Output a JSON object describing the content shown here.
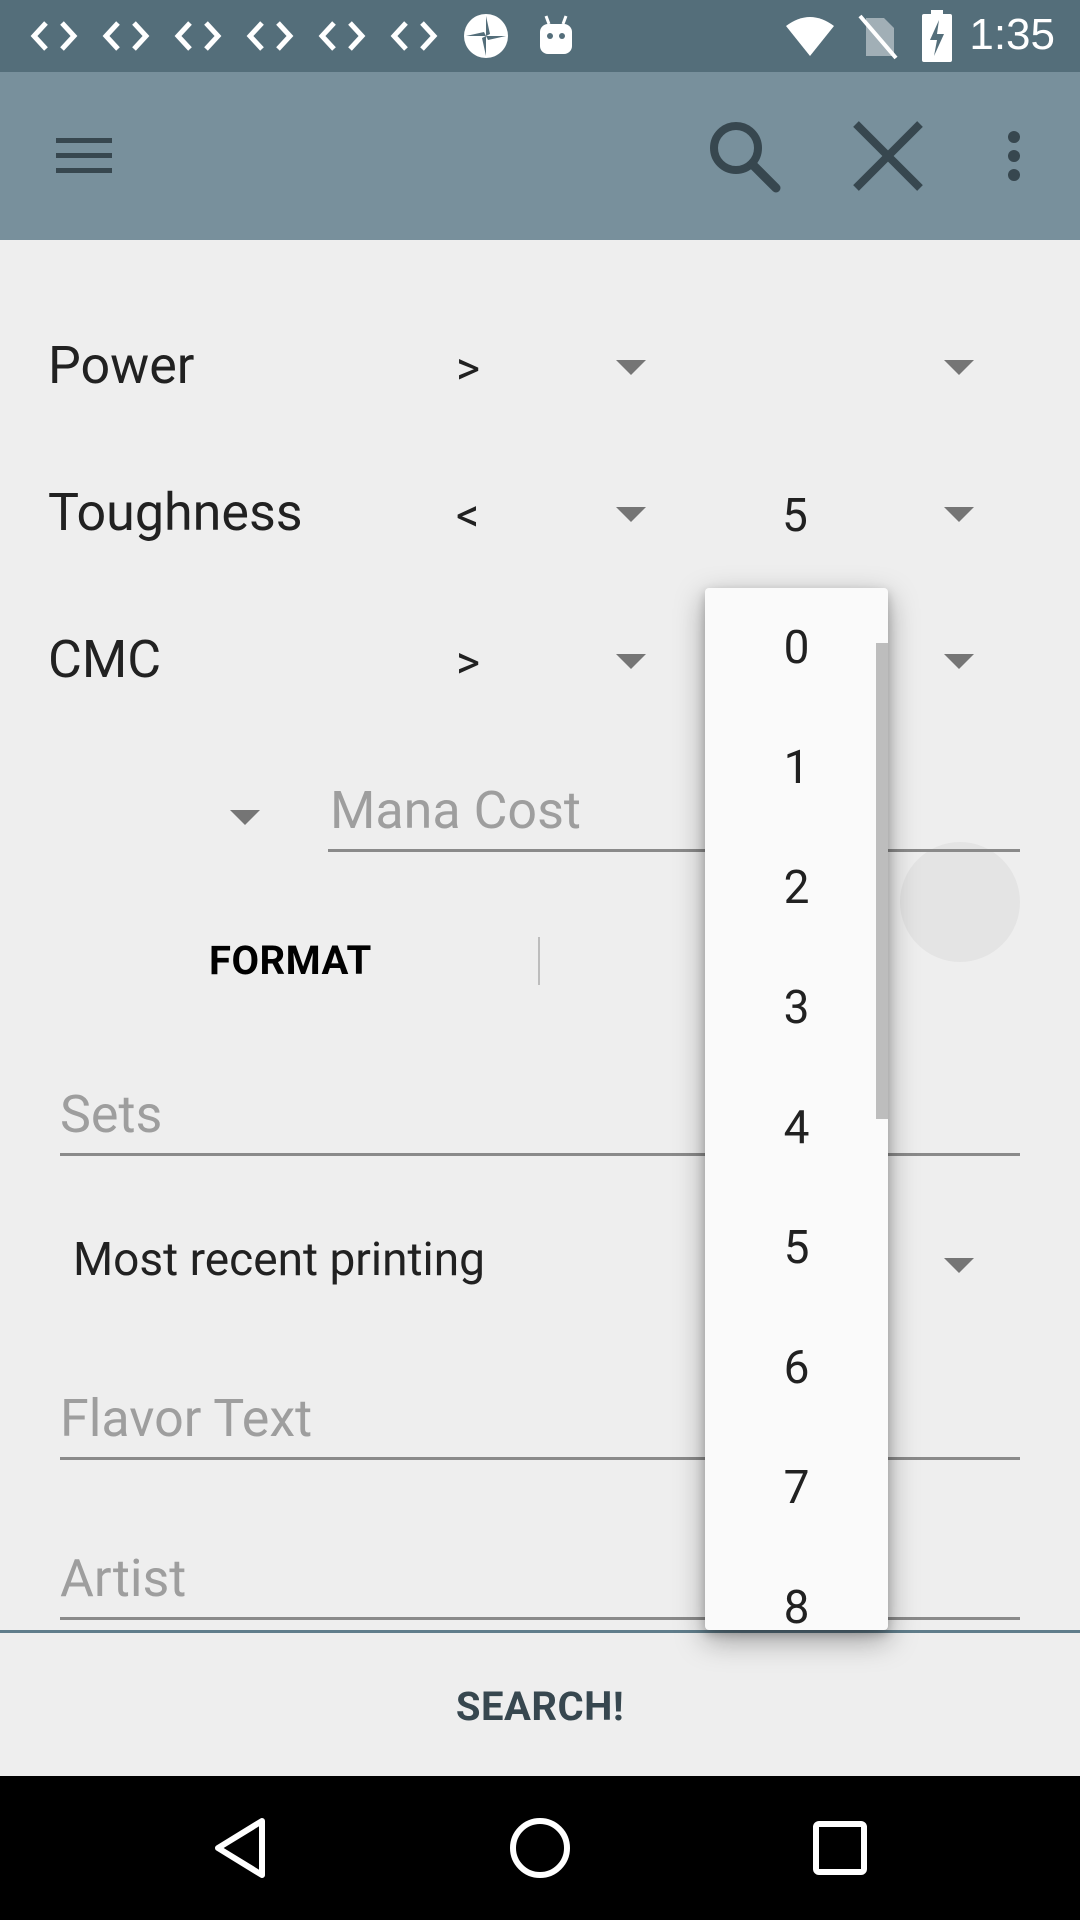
{
  "status_bar": {
    "time": "1:35",
    "notification_icons": [
      "code-icon",
      "code-icon",
      "code-icon",
      "code-icon",
      "code-icon",
      "code-icon",
      "pinwheel-icon",
      "android-icon"
    ],
    "right_icons": [
      "wifi-icon",
      "no-sim-icon",
      "battery-charging-icon"
    ]
  },
  "app_bar": {
    "menu_icon": "menu-icon",
    "search_icon": "search-icon",
    "close_icon": "close-icon",
    "overflow_icon": "more-vert-icon"
  },
  "form": {
    "power": {
      "label": "Power",
      "operator": ">",
      "value": ""
    },
    "toughness": {
      "label": "Toughness",
      "operator": "<",
      "value": "5"
    },
    "cmc": {
      "label": "CMC",
      "operator": ">",
      "value": ""
    },
    "mana_cost": {
      "placeholder": "Mana Cost"
    },
    "format": {
      "label": "FORMAT"
    },
    "sets": {
      "placeholder": "Sets"
    },
    "printing": {
      "value": "Most recent printing"
    },
    "flavor_text": {
      "placeholder": "Flavor Text"
    },
    "artist": {
      "placeholder": "Artist"
    }
  },
  "dropdown": {
    "options": [
      "0",
      "1",
      "2",
      "3",
      "4",
      "5",
      "6",
      "7",
      "8"
    ]
  },
  "search_button": {
    "label": "SEARCH!"
  },
  "colors": {
    "status_bar": "#546e7a",
    "app_bar": "#78909c",
    "background": "#eeeeee",
    "accent_text": "#37474f"
  }
}
